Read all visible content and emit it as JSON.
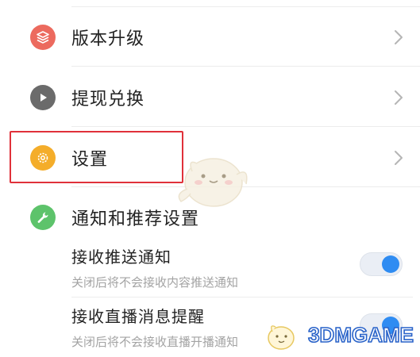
{
  "settings_list": {
    "items": [
      {
        "label": "版本升级",
        "icon": "layers-icon",
        "color": "#ec6a5e"
      },
      {
        "label": "提现兑换",
        "icon": "play-icon",
        "color": "#6b6b6b"
      },
      {
        "label": "设置",
        "icon": "gear-icon",
        "color": "#f4ad2a"
      },
      {
        "label": "通知和推荐设置",
        "icon": "wrench-icon",
        "color": "#5dc36b"
      }
    ]
  },
  "notifications": {
    "push": {
      "title": "接收推送通知",
      "desc": "关闭后将不会接收内容推送通知",
      "enabled": true
    },
    "live": {
      "title": "接收直播消息提醒",
      "desc": "关闭后将不会接收直播开播通知",
      "enabled": true
    }
  },
  "watermark": {
    "text": "3DMGAME"
  },
  "colors": {
    "highlight": "#e0313a",
    "toggle_on": "#2f8cf2"
  }
}
